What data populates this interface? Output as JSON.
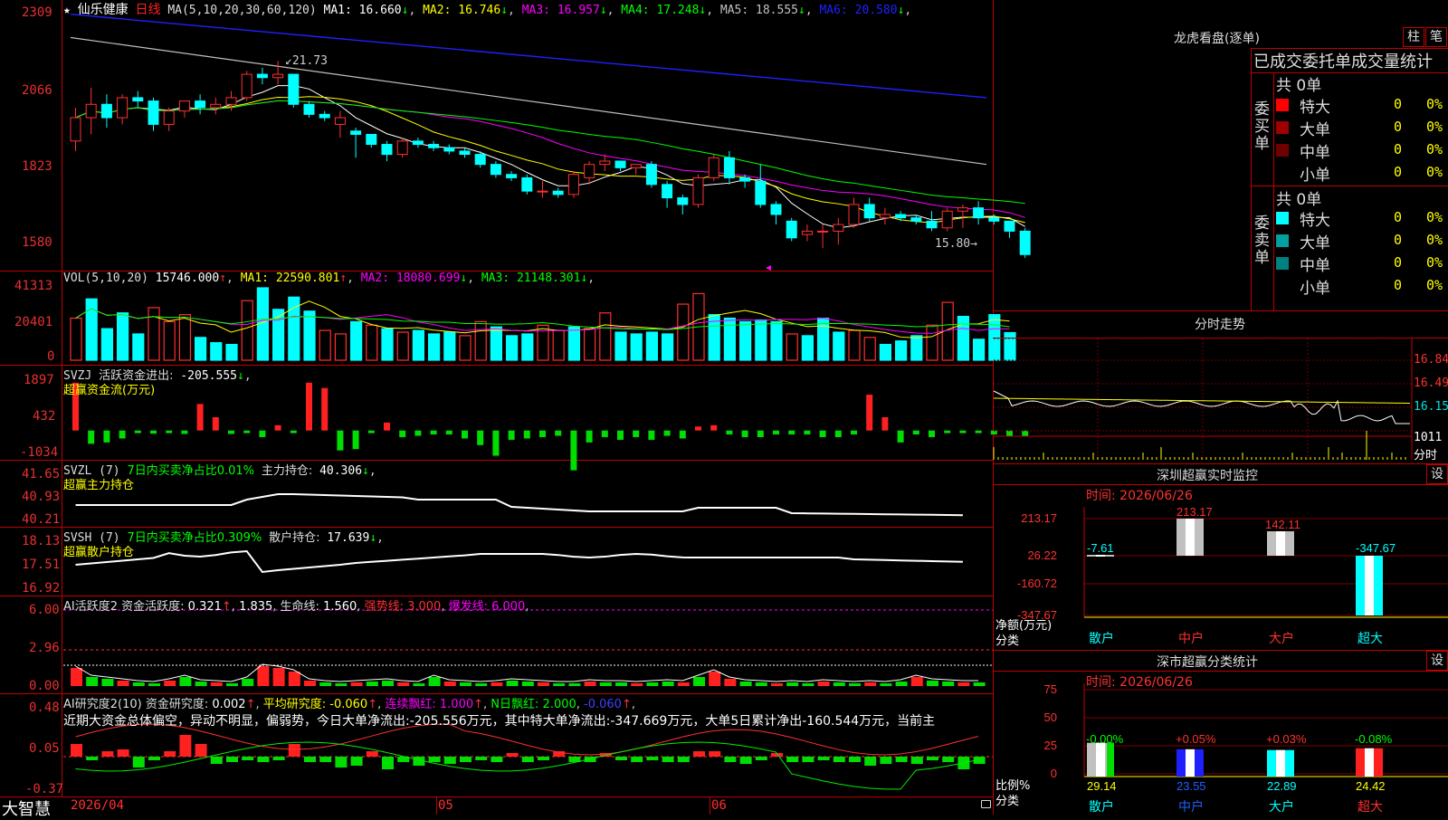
{
  "stock": {
    "star": "★",
    "name": "仙乐健康",
    "period": "日线"
  },
  "price_panel": {
    "ma_label": "MA(5,10,20,30,60,120)",
    "ma": [
      {
        "label": "MA1:",
        "value": "16.660",
        "arrow": "↓",
        "color": "#ffffff"
      },
      {
        "label": "MA2:",
        "value": "16.746",
        "arrow": "↓",
        "color": "#ffff00"
      },
      {
        "label": "MA3:",
        "value": "16.957",
        "arrow": "↓",
        "color": "#ff00ff"
      },
      {
        "label": "MA4:",
        "value": "17.248",
        "arrow": "↓",
        "color": "#00ff00"
      },
      {
        "label": "MA5:",
        "value": "18.555",
        "arrow": "↓",
        "color": "#c0c0c0"
      },
      {
        "label": "MA6:",
        "value": "20.580",
        "arrow": "↓",
        "color": "#2020ff"
      }
    ],
    "yticks": [
      "2309",
      "2066",
      "1823",
      "1580"
    ],
    "high_label": "21.73",
    "low_label": "15.80"
  },
  "vol_panel": {
    "header": "VOL(5,10,20)",
    "value": "15746.000",
    "ma": [
      {
        "label": "MA1:",
        "value": "22590.801",
        "arrow": "↑",
        "color": "#ffff00"
      },
      {
        "label": "MA2:",
        "value": "18080.699",
        "arrow": "↓",
        "color": "#ff00ff"
      },
      {
        "label": "MA3:",
        "value": "21148.301",
        "arrow": "↓",
        "color": "#00ff00"
      }
    ],
    "yticks": [
      "41313",
      "20401",
      "0"
    ]
  },
  "svzj_panel": {
    "header": "SVZJ",
    "label": "活跃资金进出:",
    "value": "-205.555",
    "arrow": "↓",
    "subtitle": "超赢资金流(万元)",
    "yticks": [
      "1897",
      "432",
      "-1034"
    ]
  },
  "svzl_panel": {
    "header": "SVZL (7)",
    "ratio": "7日内买卖净占比0.01%",
    "label": "主力持仓:",
    "value": "40.306",
    "arrow": "↓",
    "subtitle": "超赢主力持仓",
    "yticks": [
      "41.65",
      "40.93",
      "40.21"
    ]
  },
  "svsh_panel": {
    "header": "SVSH (7)",
    "ratio": "7日内买卖净占比0.309%",
    "label": "散户持仓:",
    "value": "17.639",
    "arrow": "↓",
    "subtitle": "超赢散户持仓",
    "yticks": [
      "18.13",
      "17.51",
      "16.92"
    ]
  },
  "ai_active_panel": {
    "header": "AI活跃度2",
    "label1": "资金活跃度:",
    "value1": "0.321",
    "arrow1": "↑",
    "value2": "1.835",
    "label3": "生命线:",
    "value3": "1.560",
    "label4": "强势线:",
    "value4": "3.000",
    "label5": "爆发线:",
    "value5": "6.000",
    "yticks": [
      "6.00",
      "2.96",
      "0.00"
    ]
  },
  "ai_research_panel": {
    "header": "AI研究度2(10)",
    "label1": "资金研究度:",
    "value1": "0.002",
    "arrow1": "↑",
    "label2": "平均研究度:",
    "value2": "-0.060",
    "arrow2": "↑",
    "label3": "连续飘红:",
    "value3": "1.000",
    "arrow3": "↑",
    "label4": "N日飘红:",
    "value4": "2.000",
    "value5": "-0.060",
    "arrow5": "↑",
    "comment": "近期大资金总体偏空，异动不明显，偏弱势，今日大单净流出:-205.556万元，其中特大单净流出:-347.669万元，大单5日累计净出-160.544万元，当前主",
    "yticks": [
      "0.48",
      "0.05",
      "-0.37"
    ]
  },
  "xaxis": {
    "start": "2026/04",
    "m05": "05",
    "m06": "06"
  },
  "brand": "大智慧",
  "right": {
    "title": "龙虎看盘(逐单)",
    "tab_zhu": "柱",
    "tab_bi": "笔",
    "stats_title": "已成交委托单成交量统计",
    "buy_group": {
      "label": "委买单",
      "total": "共 0单",
      "rows": [
        {
          "name": "特大",
          "vol": "0",
          "pct": "0%",
          "color": "#ff0000"
        },
        {
          "name": "大单",
          "vol": "0",
          "pct": "0%",
          "color": "#a00000"
        },
        {
          "name": "中单",
          "vol": "0",
          "pct": "0%",
          "color": "#700000"
        },
        {
          "name": "小单",
          "vol": "0",
          "pct": "0%",
          "color": "#000000"
        }
      ]
    },
    "sell_group": {
      "label": "委卖单",
      "total": "共 0单",
      "rows": [
        {
          "name": "特大",
          "vol": "0",
          "pct": "0%",
          "color": "#00ffff"
        },
        {
          "name": "大单",
          "vol": "0",
          "pct": "0%",
          "color": "#00a0a0"
        },
        {
          "name": "中单",
          "vol": "0",
          "pct": "0%",
          "color": "#008080"
        },
        {
          "name": "小单",
          "vol": "0",
          "pct": "0%",
          "color": "#000000"
        }
      ]
    },
    "intraday": {
      "title": "分时走势",
      "yticks": [
        "16.84",
        "16.49",
        "16.15"
      ],
      "vol_label": "1011",
      "vol_unit": "分时"
    },
    "monitor": {
      "title": "深圳超赢实时监控",
      "settings": "设",
      "time": "时间: 2026/06/26",
      "yticks": [
        "213.17",
        "26.22",
        "-160.72",
        "-347.67"
      ],
      "ylabel": "净额(万元)",
      "xlabel_prefix": "分类",
      "categories": [
        "散户",
        "中户",
        "大户",
        "超大"
      ],
      "bar_labels": [
        "-7.61",
        "213.17",
        "142.11",
        "-347.67"
      ]
    },
    "class_stats": {
      "title": "深市超赢分类统计",
      "settings": "设",
      "time": "时间: 2026/06/26",
      "yticks": [
        "75",
        "50",
        "25",
        "0"
      ],
      "ylabel": "比例%",
      "xlabel_prefix": "分类",
      "categories": [
        "散户",
        "中户",
        "大户",
        "超大"
      ],
      "top_labels": [
        "-0.00%",
        "+0.05%",
        "+0.03%",
        "-0.08%"
      ],
      "values": [
        "29.14",
        "23.55",
        "22.89",
        "24.42"
      ]
    }
  },
  "chart_data": [
    {
      "type": "candlestick",
      "title": "仙乐健康 日线",
      "ylim": [
        15.5,
        23.2
      ],
      "ohlc": [
        [
          19.3,
          20.3,
          19.0,
          20.0
        ],
        [
          20.0,
          20.9,
          19.5,
          20.4
        ],
        [
          20.4,
          20.7,
          19.7,
          20.0
        ],
        [
          20.0,
          20.7,
          19.8,
          20.6
        ],
        [
          20.6,
          20.8,
          20.3,
          20.5
        ],
        [
          20.5,
          20.6,
          19.6,
          19.8
        ],
        [
          19.8,
          20.3,
          19.6,
          20.2
        ],
        [
          20.2,
          20.5,
          20.0,
          20.5
        ],
        [
          20.5,
          20.7,
          20.1,
          20.3
        ],
        [
          20.3,
          20.6,
          20.1,
          20.4
        ],
        [
          20.4,
          20.8,
          20.2,
          20.6
        ],
        [
          20.6,
          21.4,
          20.5,
          21.3
        ],
        [
          21.3,
          21.5,
          21.0,
          21.2
        ],
        [
          21.2,
          21.7,
          21.0,
          21.3
        ],
        [
          21.3,
          21.3,
          20.3,
          20.4
        ],
        [
          20.4,
          20.5,
          20.0,
          20.1
        ],
        [
          20.1,
          20.2,
          19.9,
          20.0
        ],
        [
          19.8,
          20.2,
          19.4,
          20.0
        ],
        [
          19.6,
          19.7,
          18.8,
          19.5
        ],
        [
          19.5,
          19.5,
          19.1,
          19.2
        ],
        [
          19.2,
          19.3,
          18.7,
          18.9
        ],
        [
          18.9,
          19.4,
          18.8,
          19.3
        ],
        [
          19.3,
          19.4,
          19.1,
          19.2
        ],
        [
          19.2,
          19.3,
          19.0,
          19.1
        ],
        [
          19.1,
          19.2,
          18.9,
          19.0
        ],
        [
          19.0,
          19.1,
          18.8,
          18.9
        ],
        [
          18.9,
          19.0,
          18.5,
          18.6
        ],
        [
          18.6,
          18.7,
          18.2,
          18.3
        ],
        [
          18.3,
          18.4,
          18.1,
          18.2
        ],
        [
          18.2,
          18.3,
          17.7,
          17.8
        ],
        [
          17.8,
          18.1,
          17.6,
          17.8
        ],
        [
          17.8,
          17.9,
          17.6,
          17.7
        ],
        [
          17.7,
          18.4,
          17.6,
          18.3
        ],
        [
          18.2,
          18.7,
          18.0,
          18.6
        ],
        [
          18.6,
          18.9,
          18.4,
          18.7
        ],
        [
          18.7,
          18.7,
          18.4,
          18.5
        ],
        [
          18.5,
          18.6,
          18.3,
          18.6
        ],
        [
          18.6,
          18.7,
          17.9,
          18.0
        ],
        [
          18.0,
          18.1,
          17.3,
          17.6
        ],
        [
          17.6,
          17.7,
          17.1,
          17.4
        ],
        [
          17.4,
          18.3,
          17.3,
          18.2
        ],
        [
          18.2,
          18.9,
          18.1,
          18.8
        ],
        [
          18.8,
          19.0,
          18.0,
          18.2
        ],
        [
          18.2,
          18.3,
          17.9,
          18.1
        ],
        [
          18.1,
          18.6,
          17.3,
          17.4
        ],
        [
          17.4,
          17.5,
          16.8,
          17.1
        ],
        [
          16.9,
          17.0,
          16.3,
          16.4
        ],
        [
          16.5,
          16.8,
          16.3,
          16.6
        ],
        [
          16.6,
          16.8,
          16.1,
          16.6
        ],
        [
          16.6,
          17.0,
          16.2,
          16.8
        ],
        [
          16.8,
          17.6,
          16.7,
          17.4
        ],
        [
          17.4,
          17.6,
          16.9,
          17.0
        ],
        [
          17.0,
          17.3,
          16.8,
          17.1
        ],
        [
          17.1,
          17.2,
          16.9,
          17.0
        ],
        [
          17.0,
          17.1,
          16.8,
          16.9
        ],
        [
          16.9,
          17.2,
          16.6,
          16.7
        ],
        [
          16.7,
          17.3,
          16.6,
          17.2
        ],
        [
          17.2,
          17.4,
          16.7,
          17.3
        ],
        [
          17.3,
          17.5,
          16.8,
          17.0
        ],
        [
          17.0,
          17.1,
          16.8,
          16.9
        ],
        [
          16.9,
          16.9,
          16.4,
          16.6
        ],
        [
          16.6,
          16.7,
          15.8,
          15.9
        ]
      ],
      "ma_values": {
        "MA1": 16.66,
        "MA2": 16.746,
        "MA3": 16.957,
        "MA4": 17.248,
        "MA5": 18.555,
        "MA6": 20.58
      }
    },
    {
      "type": "bar",
      "title": "VOL(5,10,20)",
      "ylim": [
        0,
        41313
      ],
      "values": [
        24000,
        35000,
        18000,
        27000,
        15000,
        30000,
        22000,
        26000,
        13000,
        10000,
        9000,
        34000,
        41313,
        29000,
        36000,
        28000,
        17000,
        15000,
        22000,
        20000,
        18000,
        16000,
        17000,
        15000,
        16000,
        14000,
        22000,
        19000,
        14000,
        15000,
        20000,
        17000,
        19000,
        18000,
        27000,
        16000,
        15000,
        16000,
        15000,
        32000,
        38000,
        26000,
        24000,
        22000,
        23000,
        22000,
        15000,
        14000,
        24000,
        16000,
        17000,
        13000,
        9000,
        11000,
        14000,
        20000,
        33000,
        25000,
        12000,
        26000,
        15746
      ],
      "colors": [
        "r",
        "c",
        "c",
        "c",
        "c",
        "r",
        "r",
        "r",
        "c",
        "c",
        "c",
        "r",
        "c",
        "c",
        "c",
        "c",
        "r",
        "r",
        "c",
        "r",
        "c",
        "r",
        "c",
        "c",
        "c",
        "r",
        "r",
        "c",
        "c",
        "c",
        "r",
        "r",
        "c",
        "r",
        "r",
        "c",
        "c",
        "c",
        "c",
        "r",
        "r",
        "c",
        "c",
        "c",
        "c",
        "c",
        "r",
        "c",
        "c",
        "c",
        "r",
        "r",
        "c",
        "c",
        "c",
        "r",
        "r",
        "c",
        "c",
        "c",
        "c"
      ]
    },
    {
      "type": "bar",
      "title": "SVZJ 超赢资金流(万元)",
      "ylim": [
        -1034,
        1897
      ],
      "values": [
        1800,
        -500,
        -450,
        -300,
        -100,
        -120,
        -100,
        -130,
        1000,
        500,
        -130,
        -100,
        -250,
        200,
        -100,
        1800,
        1600,
        -750,
        -700,
        -100,
        300,
        -250,
        -200,
        -150,
        -150,
        -300,
        -550,
        -950,
        -350,
        -300,
        -250,
        -200,
        -1500,
        -450,
        -250,
        -350,
        -250,
        -350,
        -200,
        -300,
        150,
        200,
        -150,
        -250,
        -250,
        -150,
        -150,
        -150,
        -250,
        -250,
        -150,
        1350,
        500,
        -450,
        -150,
        -250,
        -100,
        -100,
        -100,
        -150,
        -200,
        -200
      ],
      "note": "estimated"
    },
    {
      "type": "bar",
      "title": "超赢散户/主力/活跃度/研究度",
      "note": "visual reproduction"
    }
  ]
}
